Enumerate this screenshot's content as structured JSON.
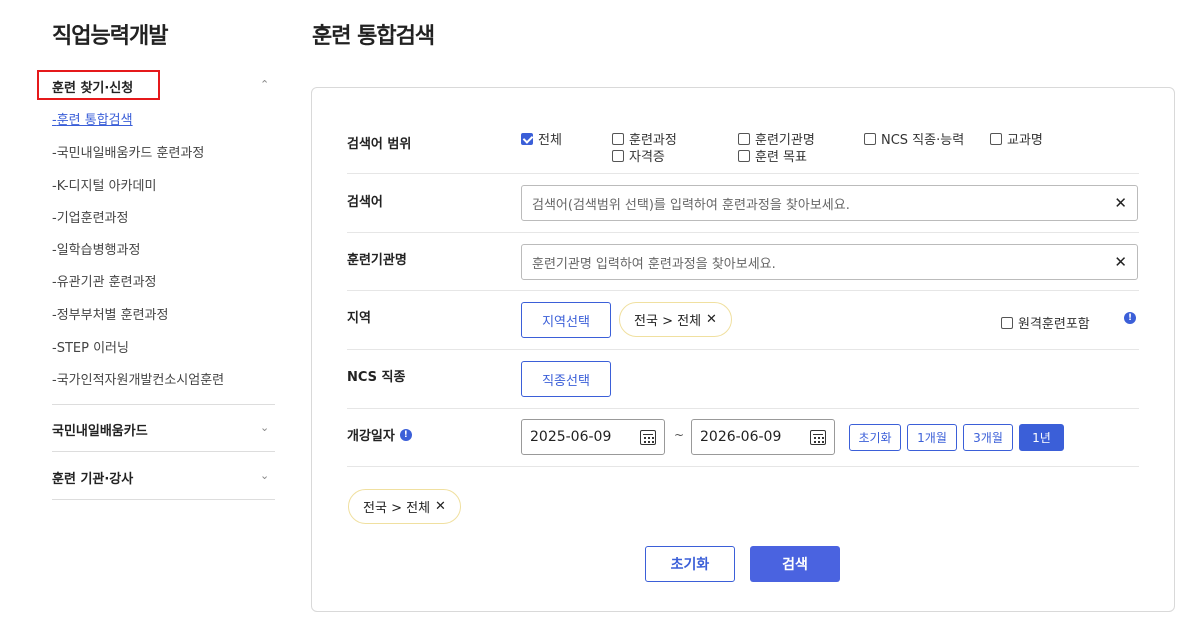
{
  "sidebar": {
    "title": "직업능력개발",
    "sections": [
      {
        "label": "훈련 찾기·신청",
        "chevron": "chevron-up-icon",
        "items": [
          "훈련 통합검색",
          "국민내일배움카드 훈련과정",
          "K-디지털 아카데미",
          "기업훈련과정",
          "일학습병행과정",
          "유관기관 훈련과정",
          "정부부처별 훈련과정",
          "STEP 이러닝",
          "국가인적자원개발컨소시엄훈련"
        ]
      },
      {
        "label": "국민내일배움카드",
        "chevron": "chevron-down-icon"
      },
      {
        "label": "훈련 기관·강사",
        "chevron": "chevron-down-icon"
      }
    ]
  },
  "main": {
    "title": "훈련 통합검색",
    "scope": {
      "label": "검색어 범위",
      "options": [
        {
          "label": "전체",
          "checked": true
        },
        {
          "label": "훈련과정",
          "checked": false
        },
        {
          "label": "훈련기관명",
          "checked": false
        },
        {
          "label": "NCS 직종·능력",
          "checked": false
        },
        {
          "label": "교과명",
          "checked": false
        },
        {
          "label": "자격증",
          "checked": false
        },
        {
          "label": "훈련 목표",
          "checked": false
        }
      ]
    },
    "keyword": {
      "label": "검색어",
      "placeholder": "검색어(검색범위 선택)를 입력하여 훈련과정을 찾아보세요."
    },
    "institution": {
      "label": "훈련기관명",
      "placeholder": "훈련기관명 입력하여 훈련과정을 찾아보세요."
    },
    "region": {
      "label": "지역",
      "button": "지역선택",
      "chip": "전국 > 전체",
      "remote_label": "원격훈련포함",
      "remote_checked": false
    },
    "ncs": {
      "label": "NCS 직종",
      "button": "직종선택"
    },
    "dates": {
      "label": "개강일자",
      "start": "2025-06-09",
      "sep": "~",
      "end": "2026-06-09",
      "ranges": [
        {
          "label": "초기화",
          "active": false
        },
        {
          "label": "1개월",
          "active": false
        },
        {
          "label": "3개월",
          "active": false
        },
        {
          "label": "1년",
          "active": true
        }
      ]
    },
    "selected_chip": "전국 > 전체",
    "reset_label": "초기화",
    "search_label": "검색"
  },
  "colors": {
    "accent": "#3b5fd8",
    "highlight": "#e5191b",
    "chip_border": "#f0e0a0"
  }
}
